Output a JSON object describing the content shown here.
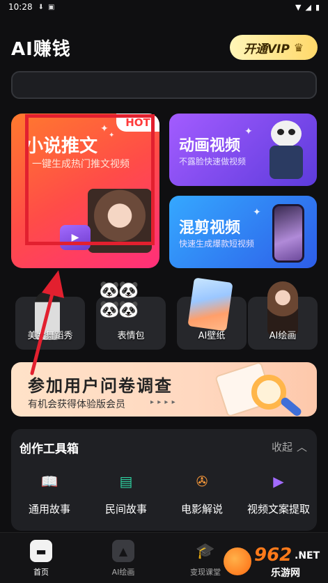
{
  "status_bar": {
    "time": "10:28",
    "icons": [
      "download-icon",
      "a-icon",
      "wifi-icon",
      "signal-icon",
      "battery-icon"
    ]
  },
  "header": {
    "title": "AI赚钱",
    "vip_label": "开通VIP"
  },
  "search": {
    "placeholder": ""
  },
  "features": {
    "novel": {
      "title": "小说推文",
      "subtitle": "一键生成热门推文视频",
      "badge": "HOT"
    },
    "animation": {
      "title": "动画视频",
      "subtitle": "不露脸快速做视频"
    },
    "remix": {
      "title": "混剪视频",
      "subtitle": "快速生成爆款短视频"
    }
  },
  "categories": [
    {
      "label": "美女舞蹈秀"
    },
    {
      "label": "表情包"
    },
    {
      "label": "AI壁纸"
    },
    {
      "label": "AI绘画"
    }
  ],
  "survey": {
    "title": "参加用户问卷调查",
    "subtitle": "有机会获得体验版会员",
    "arrows": "▸ ▸ ▸ ▸"
  },
  "toolbox": {
    "title": "创作工具箱",
    "collapse_label": "收起",
    "tools": [
      {
        "label": "通用故事",
        "icon": "book-icon",
        "color": "#4aa3ff"
      },
      {
        "label": "民间故事",
        "icon": "scroll-icon",
        "color": "#2fd0a0"
      },
      {
        "label": "电影解说",
        "icon": "film-reel-icon",
        "color": "#ff9b3a"
      },
      {
        "label": "视频文案提取",
        "icon": "video-play-icon",
        "color": "#a26bff"
      }
    ]
  },
  "tabbar": {
    "tabs": [
      {
        "label": "首页",
        "icon": "home-icon",
        "active": true
      },
      {
        "label": "AI绘画",
        "icon": "image-icon",
        "active": false
      },
      {
        "label": "变现课堂",
        "icon": "graduation-cap-icon",
        "active": false
      }
    ]
  },
  "watermark": {
    "number": "962",
    "suffix": ".NET",
    "text": "乐游网"
  },
  "colors": {
    "background": "#0f0f11",
    "accent_orange": "#ff4c48",
    "annotation_red": "#e2202f",
    "vip_gold": "#ffd86a"
  }
}
